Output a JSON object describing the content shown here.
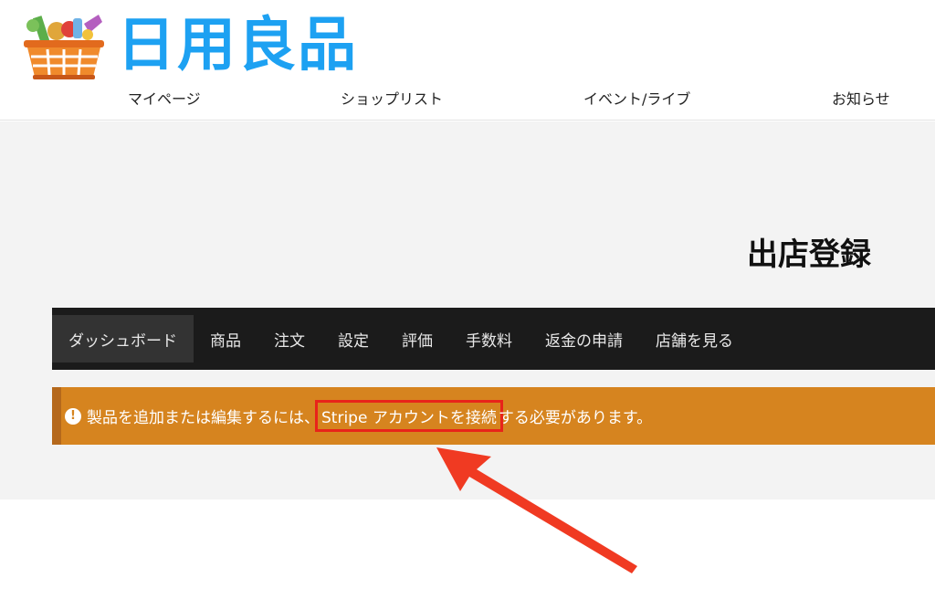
{
  "brand": {
    "logo_text": "日用良品"
  },
  "topnav": {
    "mypage": "マイページ",
    "shops": "ショップリスト",
    "events": "イベント/ライブ",
    "news": "お知らせ"
  },
  "page_title": "出店登録",
  "dashnav": [
    {
      "label": "ダッシュボード"
    },
    {
      "label": "商品"
    },
    {
      "label": "注文"
    },
    {
      "label": "設定"
    },
    {
      "label": "評価"
    },
    {
      "label": "手数料"
    },
    {
      "label": "返金の申請"
    },
    {
      "label": "店舗を見る"
    }
  ],
  "notice": {
    "icon": "exclamation-circle-icon",
    "before": "製品を追加または編集するには、",
    "link": "Stripe アカウントを接続",
    "after": "する必要があります。"
  },
  "colors": {
    "logo_blue": "#1da1f2",
    "nav_bg": "#1b1b1b",
    "notice_bg": "#d6841f",
    "highlight": "#e8231a"
  }
}
